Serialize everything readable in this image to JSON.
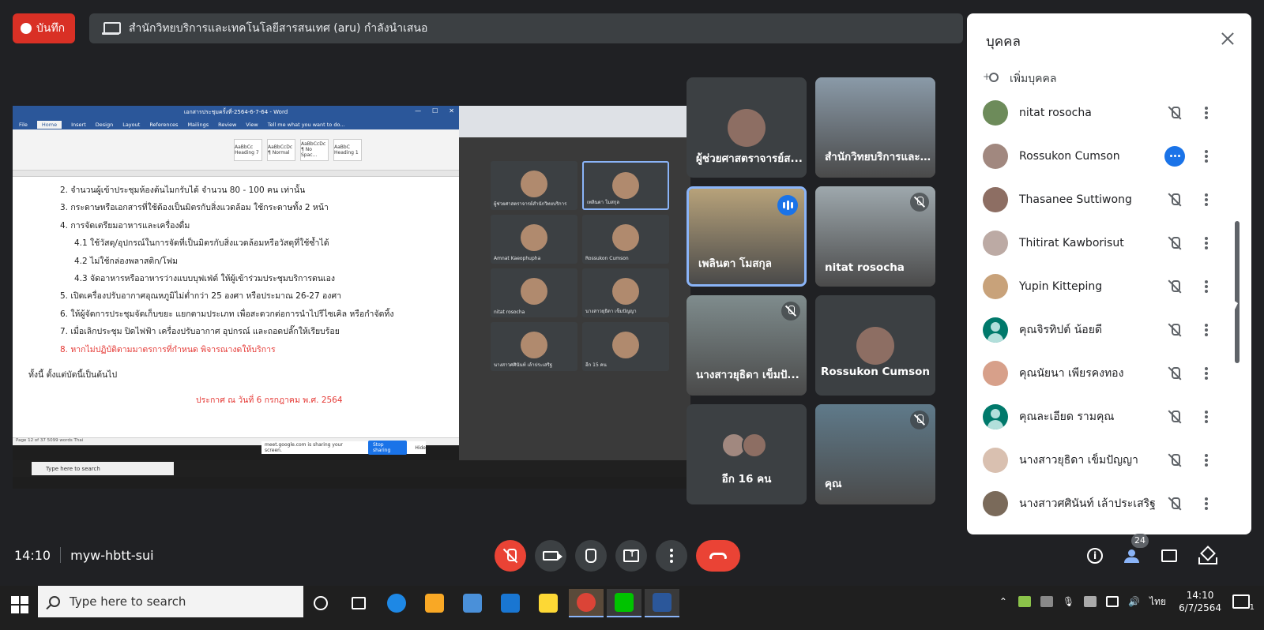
{
  "top_bar": {
    "record_label": "บันทึก",
    "presenter_text": "สำนักวิทยบริการและเทคโนโลยีสารสนเทศ (aru) กำลังนำเสนอ"
  },
  "presentation": {
    "word_title": "เอกสารประชุมครั้งที่-2564-6-7-64 - Word",
    "word_tabs": [
      "File",
      "Home",
      "Insert",
      "Design",
      "Layout",
      "References",
      "Mailings",
      "Review",
      "View",
      "Tell me what you want to do..."
    ],
    "word_styles": [
      "AaBbCc Heading 7",
      "AaBbCcDc ¶ Normal",
      "AaBbCcDc ¶ No Spac...",
      "AaBbC Heading 1"
    ],
    "doc_lines": [
      {
        "text": "2. จำนวนผู้เข้าประชุมห้องต้นไมกรับได้ จำนวน 80 - 100 คน เท่านั้น",
        "level": 1,
        "color": "normal"
      },
      {
        "text": "3. กระดาษหรือเอกสารที่ใช้ต้องเป็นมิตรกับสิ่งแวดล้อม ใช้กระดาษทั้ง 2 หน้า",
        "level": 1,
        "color": "normal"
      },
      {
        "text": "4. การจัดเตรียมอาหารและเครื่องดื่ม",
        "level": 1,
        "color": "normal"
      },
      {
        "text": "4.1 ใช้วัสดุ/อุปกรณ์ในการจัดที่เป็นมิตรกับสิ่งแวดล้อมหรือวัสดุที่ใช้ซ้ำได้",
        "level": 2,
        "color": "normal"
      },
      {
        "text": "4.2 ไม่ใช้กล่องพลาสติก/โฟม",
        "level": 2,
        "color": "normal"
      },
      {
        "text": "4.3 จัดอาหารหรืออาหารว่างแบบบุฟเฟ่ต์ ให้ผู้เข้าร่วมประชุมบริการตนเอง",
        "level": 2,
        "color": "normal"
      },
      {
        "text": "5. เปิดเครื่องปรับอากาศอุณหภูมิไม่ต่ำกว่า 25 องศา หรือประมาณ 26-27 องศา",
        "level": 1,
        "color": "normal"
      },
      {
        "text": "6. ให้ผู้จัดการประชุมจัดเก็บขยะ แยกตามประเภท เพื่อสะดวกต่อการนำไปรีไซเคิล หรือกำจัดทิ้ง",
        "level": 1,
        "color": "normal"
      },
      {
        "text": "7. เมื่อเลิกประชุม ปิดไฟฟ้า เครื่องปรับอากาศ อุปกรณ์ และถอดปลั๊กให้เรียบร้อย",
        "level": 1,
        "color": "normal"
      },
      {
        "text": "8. หากไม่ปฏิบัติตามมาตรการที่กำหนด พิจารณางดให้บริการ",
        "level": 1,
        "color": "red"
      }
    ],
    "doc_footer": "ทั้งนี้ ตั้งแต่บัดนี้เป็นต้นไป",
    "doc_announce": "ประกาศ ณ วันที่ 6 กรกฎาคม พ.ศ. 2564",
    "word_status": "Page 12 of 37     5099 words     Thai",
    "share_notice": "meet.google.com is sharing your screen.",
    "stop_sharing": "Stop sharing",
    "hide": "Hide",
    "mini_search": "Type here to search",
    "mini_tiles": [
      "ผู้ช่วยศาสตราจารย์สำนักวิทยบริการ",
      "เพลินตา โมสกุล",
      "Amnat Kaeophupha",
      "Rossukon Cumson",
      "nitat rosocha",
      "นางสาวยุธิดา เข็มปัญญา",
      "นางสาวศศินันท์ เล้าประเสริฐ",
      "อีก 15 คน"
    ]
  },
  "tiles": [
    {
      "name": "ผู้ช่วยศาสตราจารย์ส...",
      "kind": "avatar",
      "status": "none"
    },
    {
      "name": "สำนักวิทยบริการและ...",
      "kind": "video",
      "status": "none"
    },
    {
      "name": "เพลินตา โมสกุล",
      "kind": "video",
      "status": "speaking"
    },
    {
      "name": "nitat rosocha",
      "kind": "video",
      "status": "muted"
    },
    {
      "name": "นางสาวยุธิดา เข็มปั...",
      "kind": "video",
      "status": "muted"
    },
    {
      "name": "Rossukon Cumson",
      "kind": "avatar",
      "status": "none"
    },
    {
      "name": "อีก 16 คน",
      "kind": "group",
      "status": "none"
    },
    {
      "name": "คุณ",
      "kind": "video",
      "status": "muted"
    }
  ],
  "people_panel": {
    "title": "บุคคล",
    "add_person": "เพิ่มบุคคล",
    "people": [
      {
        "name": "nitat rosocha",
        "status": "muted",
        "avatar": "photo"
      },
      {
        "name": "Rossukon Cumson",
        "status": "more",
        "avatar": "photo"
      },
      {
        "name": "Thasanee Suttiwong",
        "status": "muted",
        "avatar": "photo"
      },
      {
        "name": "Thitirat Kawborisut",
        "status": "muted",
        "avatar": "photo"
      },
      {
        "name": "Yupin Kitteping",
        "status": "muted",
        "avatar": "photo"
      },
      {
        "name": "คุณจิรทิปต์ น้อยดี",
        "status": "muted",
        "avatar": "default"
      },
      {
        "name": "คุณนัยนา เพียรคงทอง",
        "status": "muted",
        "avatar": "photo"
      },
      {
        "name": "คุณละเอียด รามคุณ",
        "status": "muted",
        "avatar": "default"
      },
      {
        "name": "นางสาวยุธิดา เข็มปัญญา",
        "status": "muted",
        "avatar": "photo"
      },
      {
        "name": "นางสาวศศินันท์ เล้าประเสริฐ",
        "status": "muted",
        "avatar": "photo"
      }
    ]
  },
  "bottom": {
    "time": "14:10",
    "meeting_code": "myw-hbtt-sui",
    "participant_count": "24"
  },
  "taskbar": {
    "search_placeholder": "Type here to search",
    "language": "ไทย",
    "clock_time": "14:10",
    "clock_date": "6/7/2564",
    "notification_count": "1",
    "apps": [
      "cortana",
      "task-view",
      "edge",
      "file-explorer",
      "store",
      "mail",
      "sticky-notes",
      "chrome",
      "line",
      "word"
    ]
  },
  "colors": {
    "background": "#202124",
    "record_red": "#d93025",
    "hangup_red": "#ea4335",
    "accent_blue": "#1a73e8",
    "active_border": "#8ab4f8"
  }
}
